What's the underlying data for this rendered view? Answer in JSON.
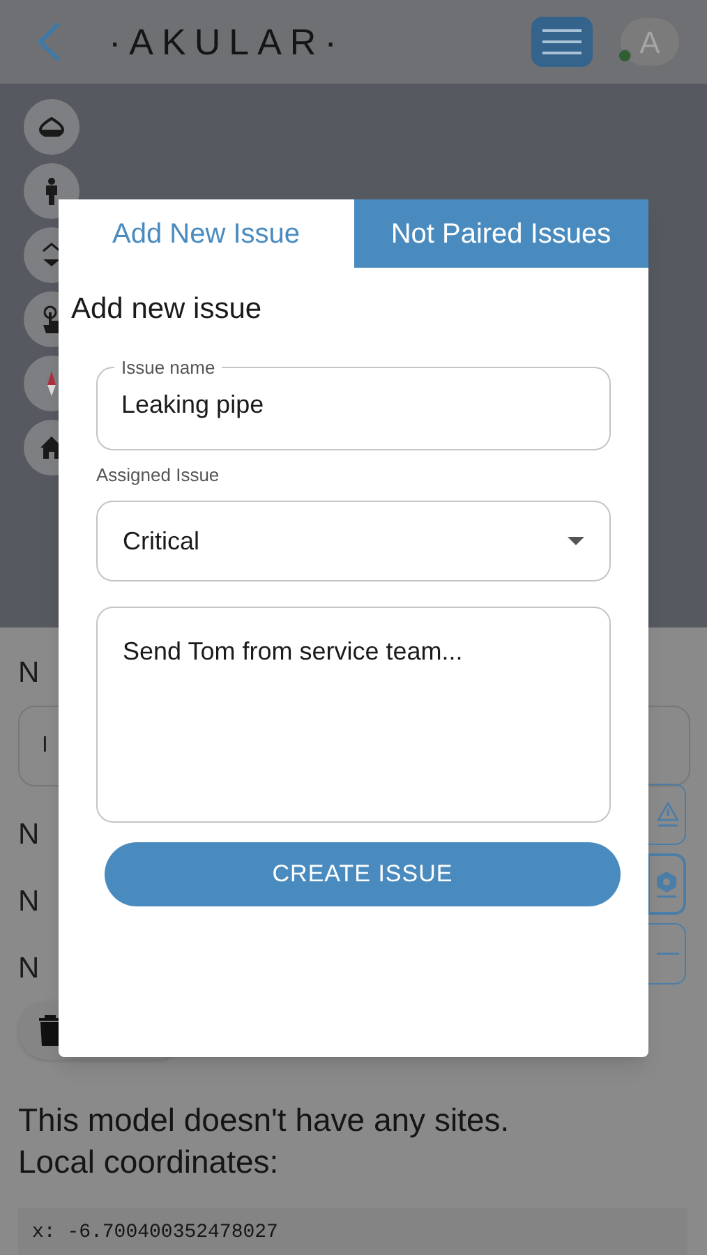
{
  "header": {
    "logo": "·AKULAR·",
    "avatar": "A"
  },
  "viewer_tools": [
    {
      "kind": "drop"
    },
    {
      "kind": "person"
    },
    {
      "kind": "updown"
    },
    {
      "kind": "touch"
    },
    {
      "kind": "compass"
    },
    {
      "kind": "home"
    }
  ],
  "background": {
    "rows": [
      {
        "label": "N",
        "kind": "heading"
      },
      {
        "label": "I",
        "kind": "field"
      },
      {
        "label": "N",
        "kind": "heading"
      },
      {
        "label": "N",
        "kind": "heading"
      },
      {
        "label": "N",
        "kind": "heading"
      }
    ],
    "side_buttons": [
      {
        "kind": "warning"
      },
      {
        "kind": "hex"
      },
      {
        "kind": "minus"
      }
    ],
    "message": "This model doesn't have any sites.",
    "coords_title": "Local coordinates:",
    "coords": [
      "x: -6.700400352478027"
    ]
  },
  "dialog": {
    "tabs": [
      {
        "label": "Add New Issue",
        "selected": true
      },
      {
        "label": "Not Paired Issues",
        "selected": false
      }
    ],
    "title": "Add new issue",
    "name_field": {
      "label": "Issue name",
      "value": "Leaking pipe"
    },
    "assigned_label": "Assigned Issue",
    "assigned_value": "Critical",
    "description": "Send Tom from service team...",
    "button": "CREATE ISSUE"
  }
}
